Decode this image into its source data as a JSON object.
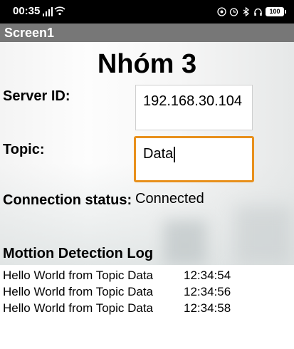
{
  "status_bar": {
    "time": "00:35",
    "icons": [
      "signal-icon",
      "wifi-icon",
      "alarm-icon",
      "clock-icon",
      "bluetooth-icon",
      "headphones-icon"
    ],
    "battery": "100"
  },
  "title_bar": {
    "title": "Screen1"
  },
  "main": {
    "group_title": "Nhóm 3",
    "server_label": "Server ID:",
    "server_value": "192.168.30.104",
    "topic_label": "Topic:",
    "topic_value": "Data",
    "connection_label": "Connection status:",
    "connection_value": "Connected",
    "log_title": "Mottion Detection Log"
  },
  "log": [
    {
      "message": "Hello World from Topic Data",
      "time": "12:34:54"
    },
    {
      "message": "Hello World from Topic Data",
      "time": "12:34:56"
    },
    {
      "message": "Hello World from Topic Data",
      "time": "12:34:58"
    }
  ],
  "colors": {
    "focus_border": "#e8901c",
    "title_bar": "#777777",
    "status_bar": "#000000"
  }
}
